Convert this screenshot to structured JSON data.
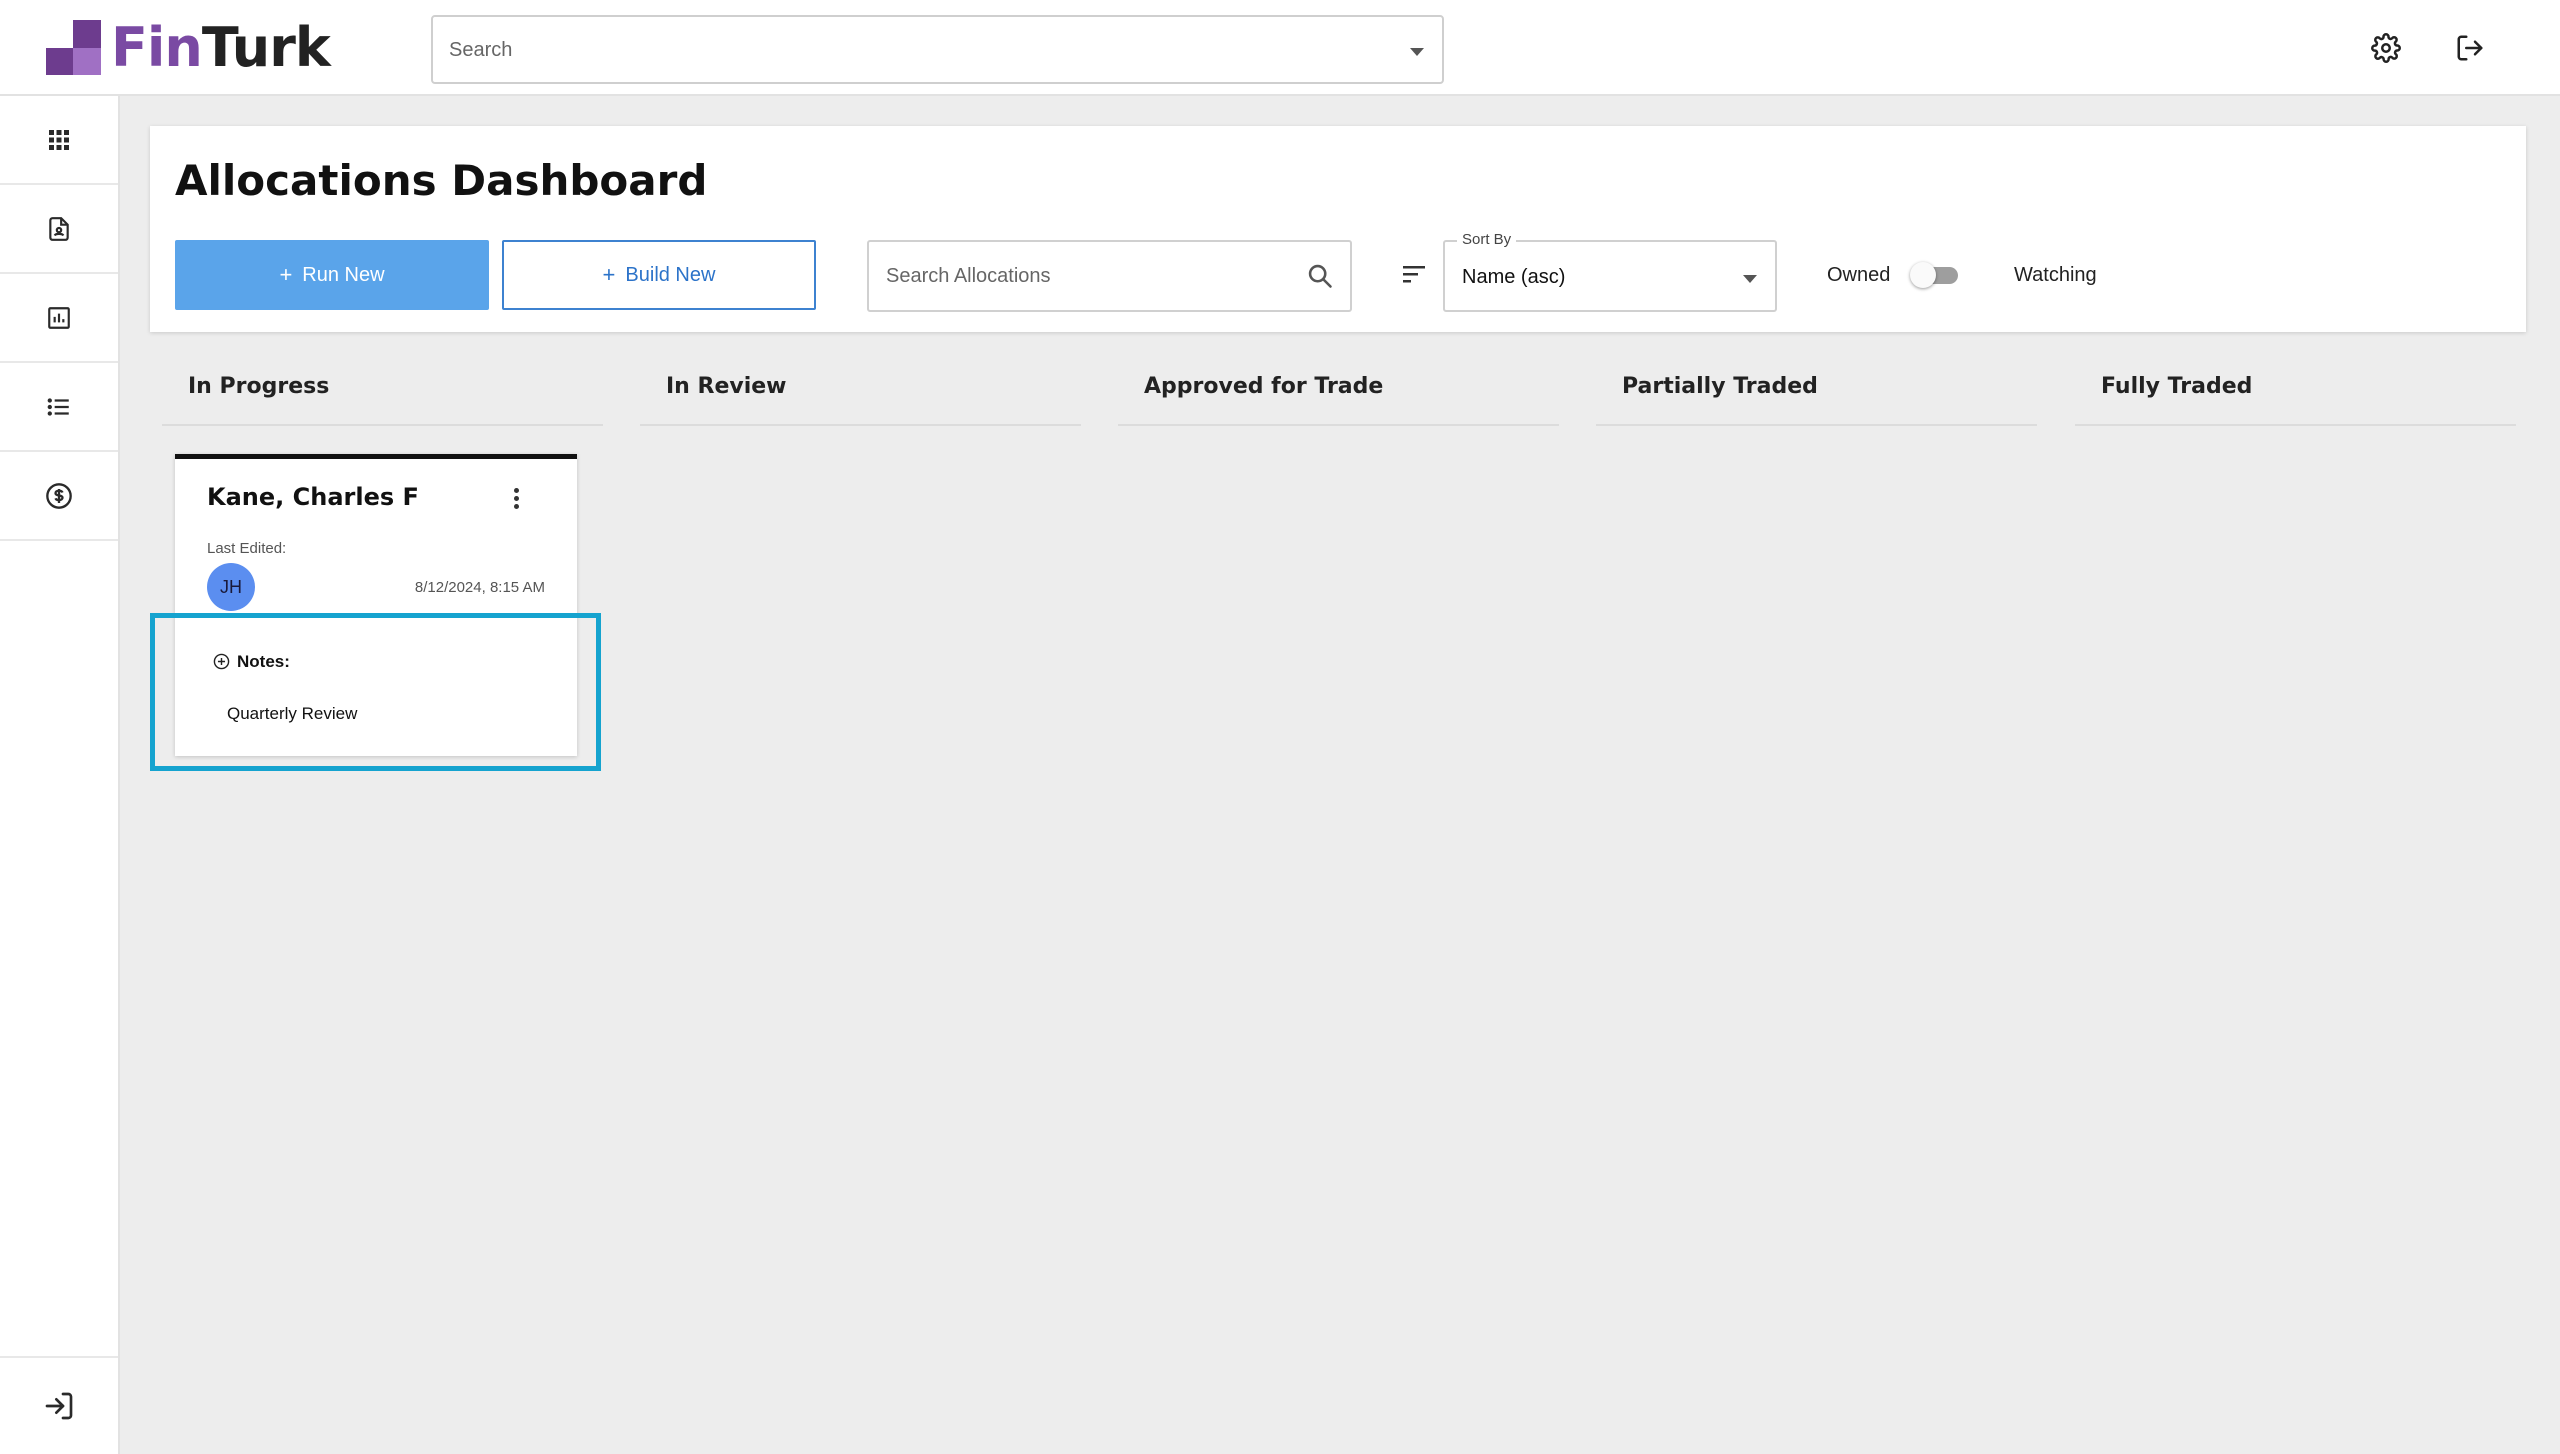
{
  "app": {
    "logo_part1": "Fin",
    "logo_part2": "Turk"
  },
  "header": {
    "search_placeholder": "Search",
    "icons": [
      "gear-icon",
      "logout-icon"
    ]
  },
  "sidebar": {
    "items": [
      {
        "icon": "apps-grid-icon"
      },
      {
        "icon": "document-icon"
      },
      {
        "icon": "bar-chart-icon"
      },
      {
        "icon": "list-icon"
      },
      {
        "icon": "dollar-icon"
      }
    ],
    "bottom_icon": "collapse-sidebar-icon"
  },
  "page": {
    "title": "Allocations Dashboard",
    "run_new_label": "Run New",
    "build_new_label": "Build New",
    "search_placeholder": "Search Allocations",
    "sort_by_label": "Sort By",
    "sort_value": "Name (asc)",
    "owned_label": "Owned",
    "watching_label": "Watching",
    "toggle_on": false
  },
  "columns": [
    {
      "label": "In Progress"
    },
    {
      "label": "In Review"
    },
    {
      "label": "Approved for Trade"
    },
    {
      "label": "Partially Traded"
    },
    {
      "label": "Fully Traded"
    }
  ],
  "cards": [
    {
      "name": "Kane, Charles F",
      "last_edited_label": "Last Edited:",
      "initials": "JH",
      "edited_at": "8/12/2024, 8:15 AM",
      "notes_label": "Notes:",
      "notes_text": "Quarterly Review"
    }
  ],
  "colors": {
    "primary": "#5aa4ea",
    "outline": "#3d82d0",
    "avatar": "#5b8ef0",
    "highlight": "#15a3cf",
    "brand_purple": "#6d3c8e"
  }
}
